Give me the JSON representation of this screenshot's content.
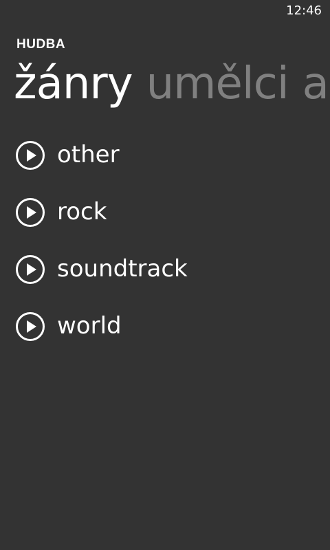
{
  "status": {
    "time": "12:46"
  },
  "app": {
    "title": "HUDBA"
  },
  "pivot": {
    "items": [
      {
        "label": "žánry",
        "active": true
      },
      {
        "label": "umělci",
        "active": false
      },
      {
        "label": "al",
        "active": false
      }
    ]
  },
  "genres": {
    "items": [
      {
        "label": "other",
        "icon": "play-circle-icon"
      },
      {
        "label": "rock",
        "icon": "play-circle-icon"
      },
      {
        "label": "soundtrack",
        "icon": "play-circle-icon"
      },
      {
        "label": "world",
        "icon": "play-circle-icon"
      }
    ]
  },
  "colors": {
    "background": "#333333",
    "foreground": "#ffffff",
    "inactive_pivot": "#808080"
  }
}
